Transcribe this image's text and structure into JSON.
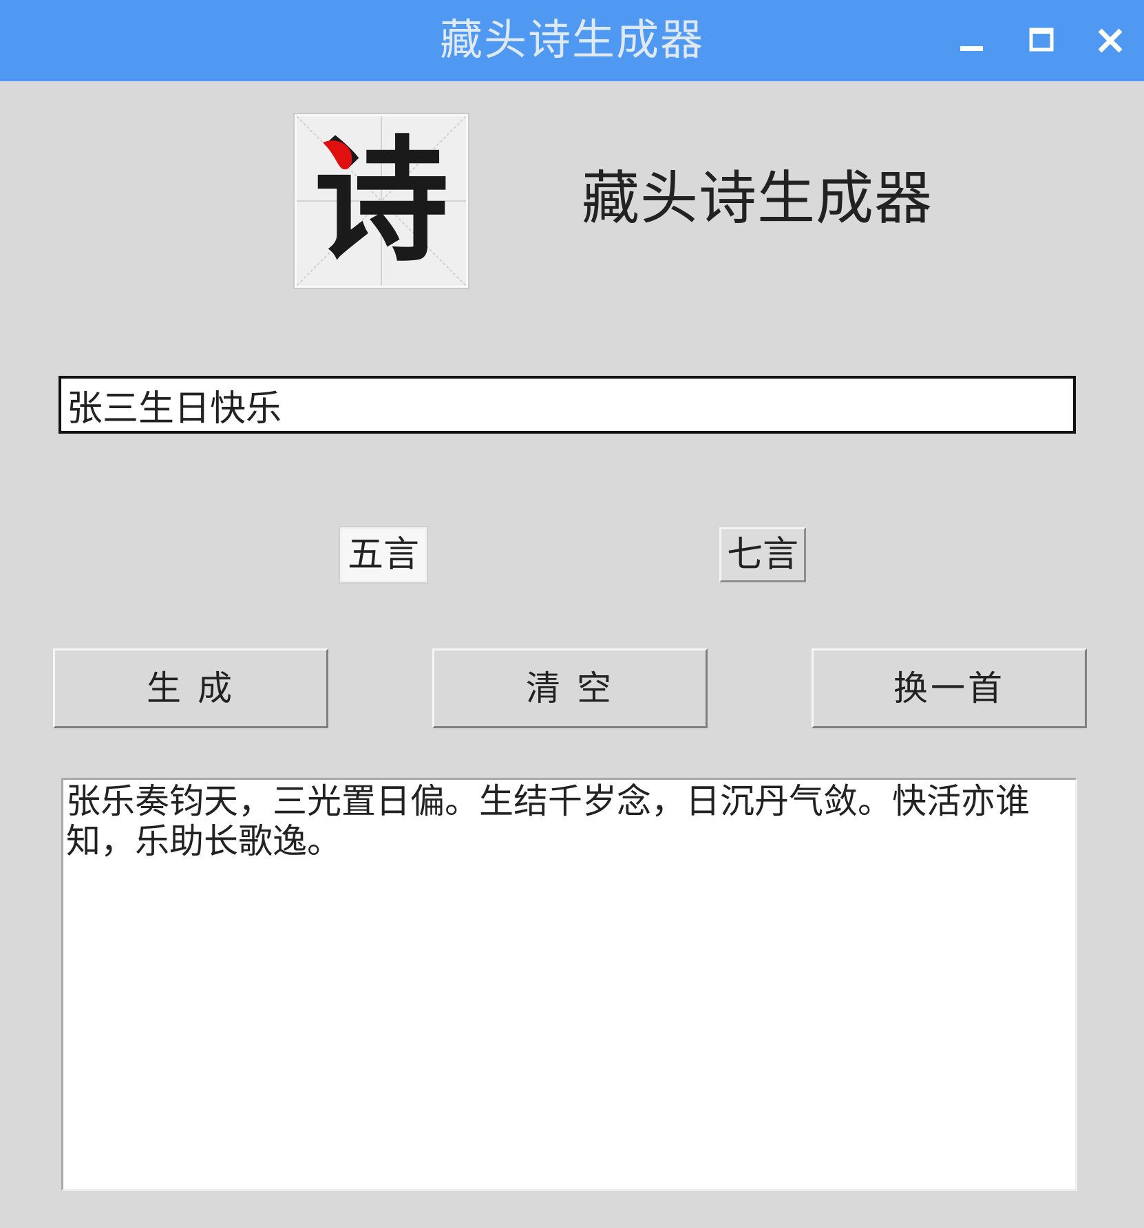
{
  "window": {
    "title": "藏头诗生成器",
    "controls": [
      "minimize-icon",
      "maximize-icon",
      "close-icon"
    ],
    "titlebar_color": "#4f99f2"
  },
  "header": {
    "logo_char": "诗",
    "heading": "藏头诗生成器"
  },
  "input": {
    "value": "张三生日快乐"
  },
  "mode": {
    "options": [
      "五言",
      "七言"
    ],
    "selected": "五言"
  },
  "buttons": {
    "generate": "生 成",
    "clear": "清 空",
    "another": "换一首"
  },
  "output": {
    "text": "张乐奏钧天，三光置日偏。生结千岁念，日沉丹气敛。快活亦谁知，乐助长歌逸。"
  }
}
